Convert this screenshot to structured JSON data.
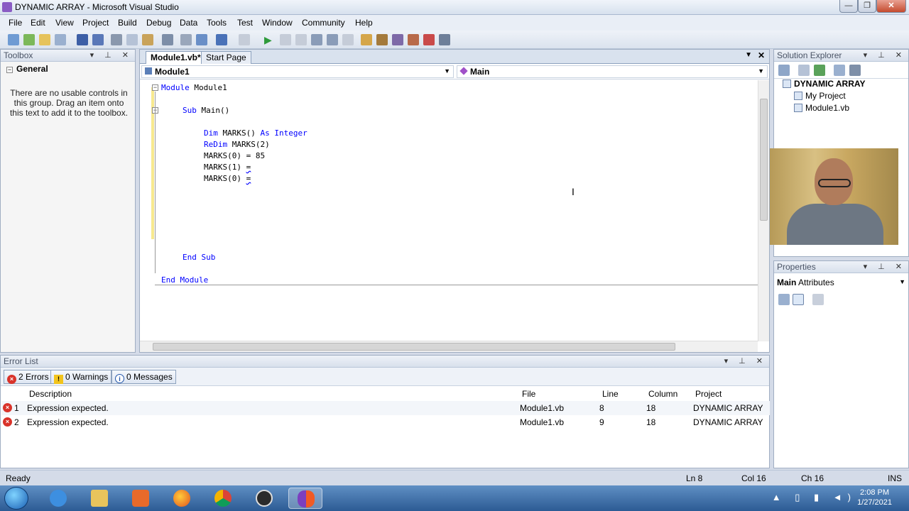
{
  "window": {
    "title": "DYNAMIC ARRAY - Microsoft Visual Studio",
    "buttons": {
      "minimize": "—",
      "restore": "❐",
      "close": "✕"
    }
  },
  "menu": [
    "File",
    "Edit",
    "View",
    "Project",
    "Build",
    "Debug",
    "Data",
    "Tools",
    "Test",
    "Window",
    "Community",
    "Help"
  ],
  "toolbox": {
    "title": "Toolbox",
    "group": "General",
    "message": "There are no usable controls in this group. Drag an item onto this text to add it to the toolbox."
  },
  "editor": {
    "tabs": [
      {
        "label": "Module1.vb*",
        "active": true
      },
      {
        "label": "Start Page",
        "active": false
      }
    ],
    "nav_left": "Module1",
    "nav_right": "Main",
    "code": {
      "line1_kw": "Module",
      "line1_rest": " Module1",
      "line2_kw": "Sub",
      "line2_rest": " Main()",
      "line3_kw1": "Dim",
      "line3_mid": " MARKS() ",
      "line3_kw2": "As",
      "line3_sp": " ",
      "line3_kw3": "Integer",
      "line4_kw": "ReDim",
      "line4_rest": " MARKS(2)",
      "line5": "MARKS(0) = 85",
      "line6_text": "MARKS(1) ",
      "line6_err": "=",
      "line7_text": "MARKS(0) ",
      "line7_err": "=",
      "line8_kw": "End Sub",
      "line9_kw": "End Module"
    }
  },
  "solution_explorer": {
    "title": "Solution Explorer",
    "root": "DYNAMIC ARRAY",
    "items": [
      "My Project",
      "Module1.vb"
    ]
  },
  "properties": {
    "title": "Properties",
    "object": "Main",
    "object_type": "Attributes"
  },
  "error_list": {
    "title": "Error List",
    "filters": {
      "errors": "2 Errors",
      "warnings": "0 Warnings",
      "messages": "0 Messages"
    },
    "columns": [
      "Description",
      "File",
      "Line",
      "Column",
      "Project"
    ],
    "rows": [
      {
        "num": "1",
        "description": "Expression expected.",
        "file": "Module1.vb",
        "line": "8",
        "column": "18",
        "project": "DYNAMIC ARRAY"
      },
      {
        "num": "2",
        "description": "Expression expected.",
        "file": "Module1.vb",
        "line": "9",
        "column": "18",
        "project": "DYNAMIC ARRAY"
      }
    ]
  },
  "status": {
    "ready": "Ready",
    "ln": "Ln 8",
    "col": "Col 16",
    "ch": "Ch 16",
    "ins": "INS"
  },
  "taskbar": {
    "time": "2:08 PM",
    "date": "1/27/2021"
  },
  "colors": {
    "keyword": "#0000ff",
    "error": "#d9332a",
    "accent": "#2c5b94"
  }
}
